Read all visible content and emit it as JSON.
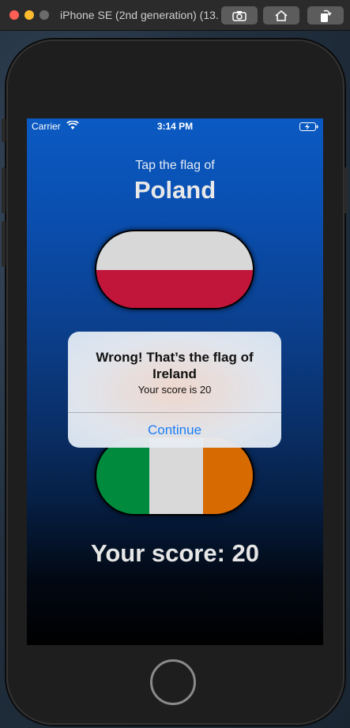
{
  "window": {
    "title": "iPhone SE (2nd generation) (13..."
  },
  "status_bar": {
    "carrier": "Carrier",
    "time": "3:14 PM"
  },
  "game": {
    "prompt": "Tap the flag of",
    "country": "Poland",
    "flags": [
      {
        "name": "Poland",
        "colors": [
          "#d8d8d8",
          "#c2153a"
        ]
      },
      {
        "name": "Ireland",
        "colors": [
          "#008a3e",
          "#d9d9d9",
          "#d76a00"
        ]
      }
    ],
    "score_text": "Your score: 20"
  },
  "alert": {
    "title": "Wrong! That’s the flag of Ireland",
    "message": "Your score is 20",
    "button": "Continue"
  },
  "colors": {
    "accent": "#1a7ef5",
    "background_top": "#0a5ac3",
    "background_bottom": "#000000"
  }
}
